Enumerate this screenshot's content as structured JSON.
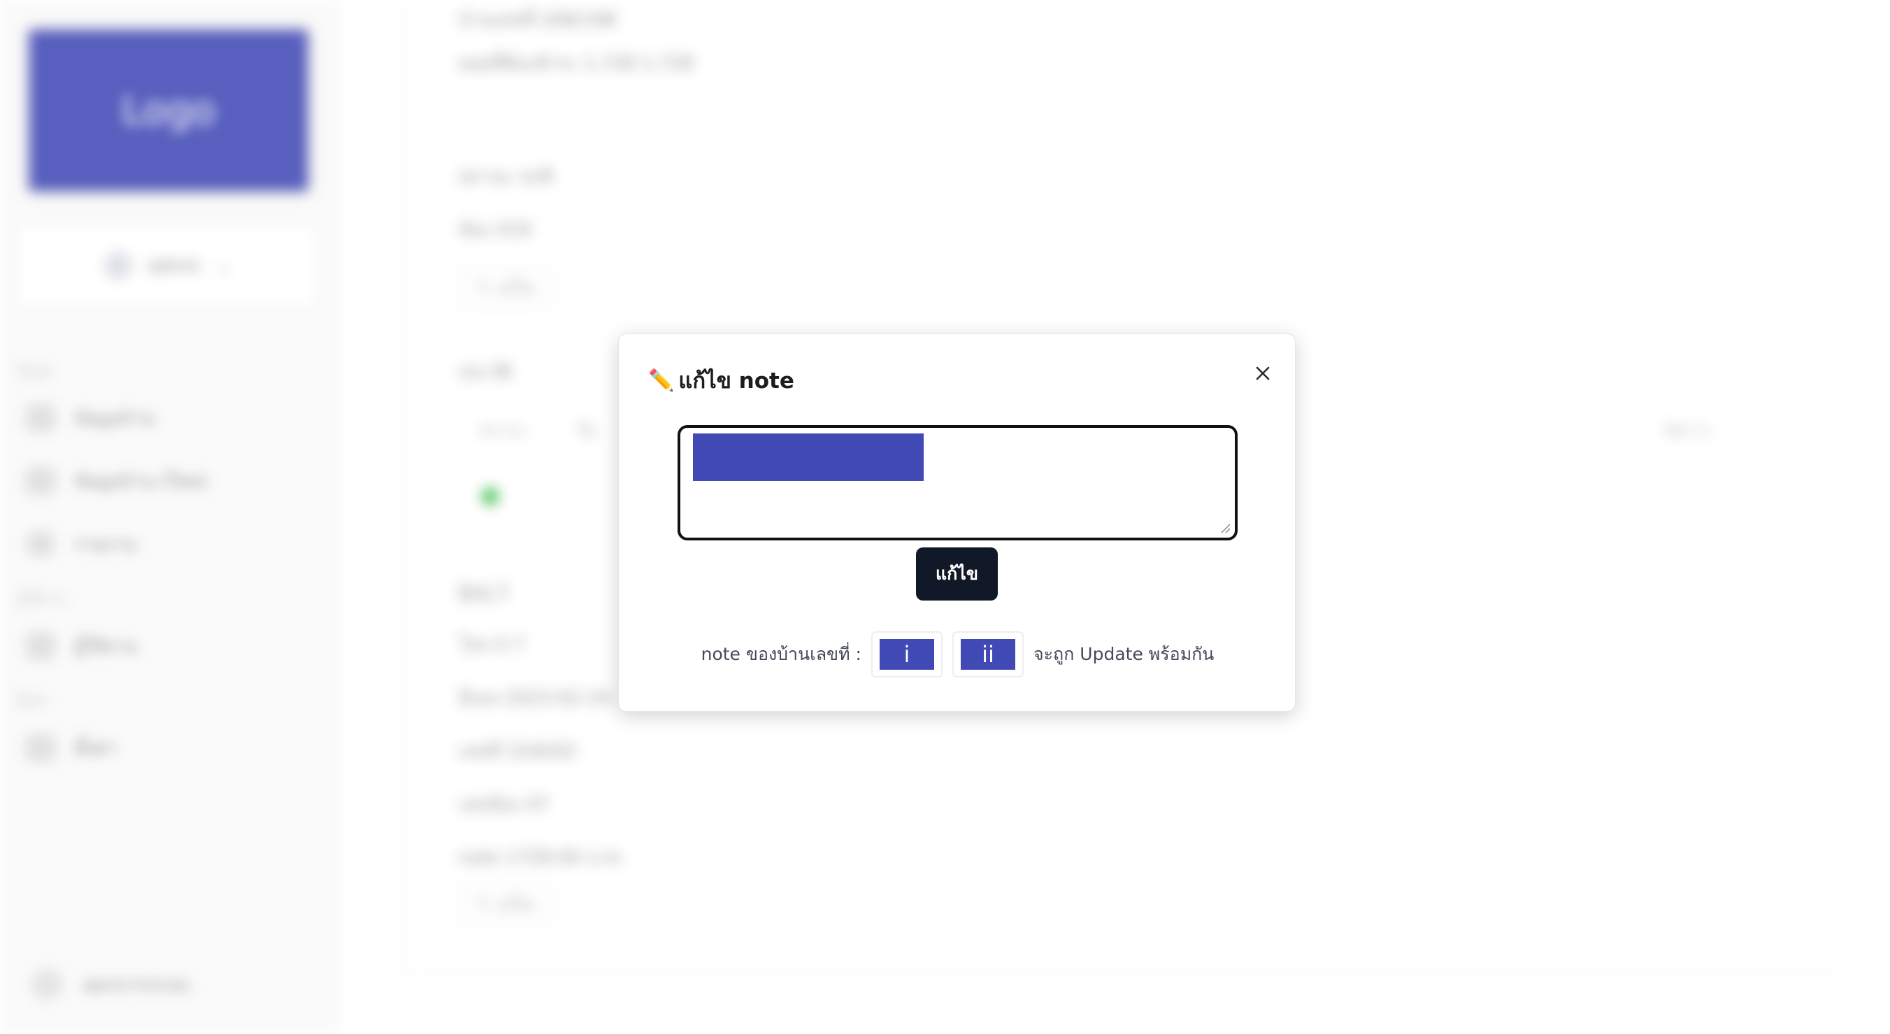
{
  "sidebar": {
    "logo_text": "Logo",
    "user_name": "admin",
    "section_1": "ข้อมูล",
    "section_2": "ผู้ใช้งาน",
    "section_3": "ตั้งค่า",
    "items": [
      {
        "label": "ข้อมูลบ้าน",
        "icon": "table-icon"
      },
      {
        "label": "ข้อมูลบ้าน (ใหม่)",
        "icon": "table-icon"
      },
      {
        "label": "รายงาน",
        "icon": "globe-icon"
      },
      {
        "label": "ผู้ใช้งาน",
        "icon": "user-icon"
      },
      {
        "label": "ตั้งค่า",
        "icon": "gear-icon"
      }
    ],
    "logout": "ออกจากระบบ"
  },
  "main": {
    "lines": [
      "บ้านเลขที่ 208/198",
      "ยอดที่ต้องชำระ 1,728   1,728",
      "สถานะ ปกติ",
      "ห้อง 419",
      "ประวัติ",
      "ผู้อยู่ 2",
      "โทร 0 7",
      "อีเมล 2023-02-24",
      "เลขที่ 15/6/02",
      "เลขห้อง 47",
      "note 1728.00 บาท"
    ],
    "edit_label": "แก้ไข",
    "table_headers": [
      "สถานะ",
      "ชื่อ",
      "จัดการ"
    ]
  },
  "modal": {
    "title": "แก้ไข note",
    "title_icon": "pencil-icon",
    "textarea_value": "",
    "submit_label": "แก้ไข",
    "note_prefix": "note ของบ้านเลขที่ :",
    "house_numbers": [
      "i",
      "ii"
    ],
    "note_suffix": "จะถูก Update พร้อมกัน",
    "close_icon": "close-icon",
    "accent_color": "#4149b5",
    "button_color": "#111827"
  }
}
